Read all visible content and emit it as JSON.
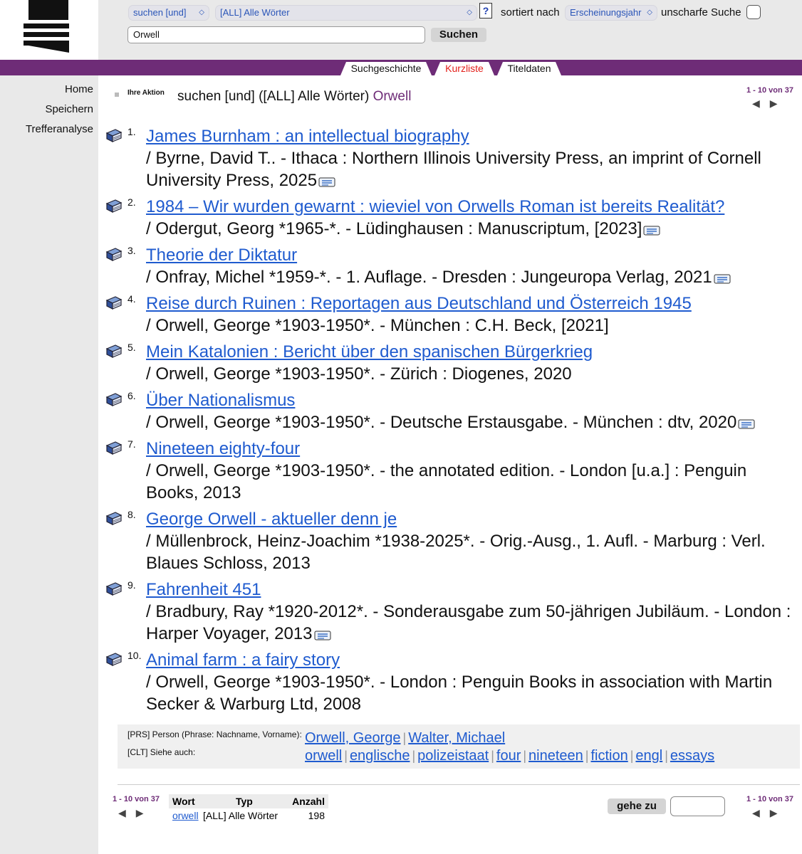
{
  "search": {
    "operator": "suchen [und]",
    "field": "[ALL] Alle Wörter",
    "help": "?",
    "sort_label": "sortiert nach",
    "sort_value": "Erscheinungsjahr",
    "fuzzy_label": "unscharfe Suche",
    "query": "Orwell",
    "submit": "Suchen"
  },
  "tabs": [
    {
      "label": "Suchgeschichte",
      "active": false
    },
    {
      "label": "Kurzliste",
      "active": true
    },
    {
      "label": "Titeldaten",
      "active": false
    }
  ],
  "sidebar": [
    "Home",
    "Speichern",
    "Trefferanalyse"
  ],
  "action": {
    "label": "Ihre Aktion",
    "text": "suchen [und] ([ALL] Alle Wörter)",
    "term": "Orwell"
  },
  "pager": {
    "range": "1 - 10 von 37"
  },
  "results": [
    {
      "num": "1.",
      "title": "James Burnham : an intellectual biography",
      "meta": "/ Byrne, David T.. - Ithaca : Northern Illinois University Press, an imprint of Cornell University Press, 2025",
      "card": true
    },
    {
      "num": "2.",
      "title": "1984 – Wir wurden gewarnt : wieviel von Orwells Roman ist bereits Realität?",
      "meta": "/ Odergut, Georg *1965-*. - Lüdinghausen : Manuscriptum, [2023]",
      "card": true
    },
    {
      "num": "3.",
      "title": "Theorie der Diktatur",
      "meta": "/ Onfray, Michel *1959-*. - 1. Auflage. - Dresden : Jungeuropa Verlag, 2021",
      "card": true
    },
    {
      "num": "4.",
      "title": "Reise durch Ruinen : Reportagen aus Deutschland und Österreich 1945",
      "meta": "/ Orwell, George *1903-1950*. - München : C.H. Beck, [2021]",
      "card": false
    },
    {
      "num": "5.",
      "title": "Mein Katalonien : Bericht über den spanischen Bürgerkrieg",
      "meta": "/ Orwell, George *1903-1950*. - Zürich : Diogenes, 2020",
      "card": false
    },
    {
      "num": "6.",
      "title": "Über Nationalismus",
      "meta": "/ Orwell, George *1903-1950*. - Deutsche Erstausgabe. - München : dtv, 2020",
      "card": true
    },
    {
      "num": "7.",
      "title": "Nineteen eighty-four",
      "meta": "/ Orwell, George *1903-1950*. - the annotated edition. - London [u.a.] : Penguin Books, 2013",
      "card": false
    },
    {
      "num": "8.",
      "title": "George Orwell - aktueller denn je",
      "meta": "/ Müllenbrock, Heinz-Joachim *1938-2025*. - Orig.-Ausg., 1. Aufl. - Marburg : Verl. Blaues Schloss, 2013",
      "card": false
    },
    {
      "num": "9.",
      "title": "Fahrenheit 451",
      "meta": "/ Bradbury, Ray *1920-2012*. - Sonderausgabe zum 50-jährigen Jubiläum. - London : Harper Voyager, 2013",
      "card": true
    },
    {
      "num": "10.",
      "title": "Animal farm : a fairy story",
      "meta": "/ Orwell, George *1903-1950*. - London : Penguin Books in association with Martin Secker & Warburg Ltd, 2008",
      "card": false
    }
  ],
  "related": {
    "prs_label": "[PRS] Person (Phrase: Nachname, Vorname):",
    "prs_links": [
      "Orwell, George",
      "Walter, Michael"
    ],
    "clt_label": "[CLT] Siehe auch:",
    "clt_links": [
      "orwell",
      "englische",
      "polizeistaat",
      "four",
      "nineteen",
      "fiction",
      "engl",
      "essays"
    ]
  },
  "word_table": {
    "headers": [
      "Wort",
      "Typ",
      "Anzahl"
    ],
    "row": {
      "word": "orwell",
      "type": "[ALL] Alle Wörter",
      "count": "198"
    }
  },
  "goto": {
    "button": "gehe zu",
    "value": ""
  }
}
